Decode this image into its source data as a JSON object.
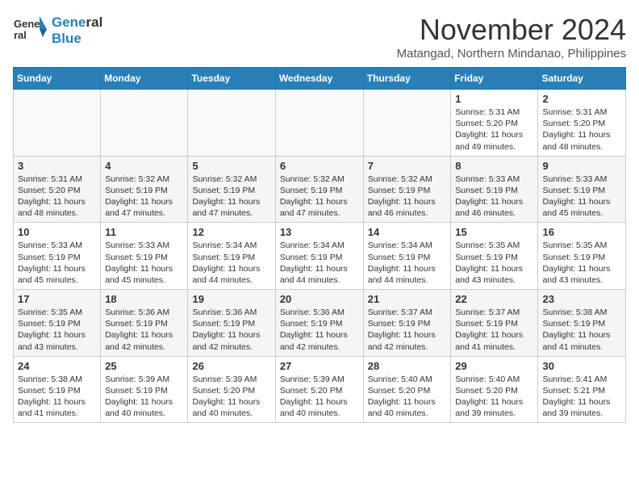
{
  "logo": {
    "name_line1": "General",
    "name_line2": "Blue"
  },
  "title": {
    "month_year": "November 2024",
    "location": "Matangad, Northern Mindanao, Philippines"
  },
  "weekdays": [
    "Sunday",
    "Monday",
    "Tuesday",
    "Wednesday",
    "Thursday",
    "Friday",
    "Saturday"
  ],
  "weeks": [
    [
      {
        "day": "",
        "info": ""
      },
      {
        "day": "",
        "info": ""
      },
      {
        "day": "",
        "info": ""
      },
      {
        "day": "",
        "info": ""
      },
      {
        "day": "",
        "info": ""
      },
      {
        "day": "1",
        "info": "Sunrise: 5:31 AM\nSunset: 5:20 PM\nDaylight: 11 hours and 49 minutes."
      },
      {
        "day": "2",
        "info": "Sunrise: 5:31 AM\nSunset: 5:20 PM\nDaylight: 11 hours and 48 minutes."
      }
    ],
    [
      {
        "day": "3",
        "info": "Sunrise: 5:31 AM\nSunset: 5:20 PM\nDaylight: 11 hours and 48 minutes."
      },
      {
        "day": "4",
        "info": "Sunrise: 5:32 AM\nSunset: 5:19 PM\nDaylight: 11 hours and 47 minutes."
      },
      {
        "day": "5",
        "info": "Sunrise: 5:32 AM\nSunset: 5:19 PM\nDaylight: 11 hours and 47 minutes."
      },
      {
        "day": "6",
        "info": "Sunrise: 5:32 AM\nSunset: 5:19 PM\nDaylight: 11 hours and 47 minutes."
      },
      {
        "day": "7",
        "info": "Sunrise: 5:32 AM\nSunset: 5:19 PM\nDaylight: 11 hours and 46 minutes."
      },
      {
        "day": "8",
        "info": "Sunrise: 5:33 AM\nSunset: 5:19 PM\nDaylight: 11 hours and 46 minutes."
      },
      {
        "day": "9",
        "info": "Sunrise: 5:33 AM\nSunset: 5:19 PM\nDaylight: 11 hours and 45 minutes."
      }
    ],
    [
      {
        "day": "10",
        "info": "Sunrise: 5:33 AM\nSunset: 5:19 PM\nDaylight: 11 hours and 45 minutes."
      },
      {
        "day": "11",
        "info": "Sunrise: 5:33 AM\nSunset: 5:19 PM\nDaylight: 11 hours and 45 minutes."
      },
      {
        "day": "12",
        "info": "Sunrise: 5:34 AM\nSunset: 5:19 PM\nDaylight: 11 hours and 44 minutes."
      },
      {
        "day": "13",
        "info": "Sunrise: 5:34 AM\nSunset: 5:19 PM\nDaylight: 11 hours and 44 minutes."
      },
      {
        "day": "14",
        "info": "Sunrise: 5:34 AM\nSunset: 5:19 PM\nDaylight: 11 hours and 44 minutes."
      },
      {
        "day": "15",
        "info": "Sunrise: 5:35 AM\nSunset: 5:19 PM\nDaylight: 11 hours and 43 minutes."
      },
      {
        "day": "16",
        "info": "Sunrise: 5:35 AM\nSunset: 5:19 PM\nDaylight: 11 hours and 43 minutes."
      }
    ],
    [
      {
        "day": "17",
        "info": "Sunrise: 5:35 AM\nSunset: 5:19 PM\nDaylight: 11 hours and 43 minutes."
      },
      {
        "day": "18",
        "info": "Sunrise: 5:36 AM\nSunset: 5:19 PM\nDaylight: 11 hours and 42 minutes."
      },
      {
        "day": "19",
        "info": "Sunrise: 5:36 AM\nSunset: 5:19 PM\nDaylight: 11 hours and 42 minutes."
      },
      {
        "day": "20",
        "info": "Sunrise: 5:36 AM\nSunset: 5:19 PM\nDaylight: 11 hours and 42 minutes."
      },
      {
        "day": "21",
        "info": "Sunrise: 5:37 AM\nSunset: 5:19 PM\nDaylight: 11 hours and 42 minutes."
      },
      {
        "day": "22",
        "info": "Sunrise: 5:37 AM\nSunset: 5:19 PM\nDaylight: 11 hours and 41 minutes."
      },
      {
        "day": "23",
        "info": "Sunrise: 5:38 AM\nSunset: 5:19 PM\nDaylight: 11 hours and 41 minutes."
      }
    ],
    [
      {
        "day": "24",
        "info": "Sunrise: 5:38 AM\nSunset: 5:19 PM\nDaylight: 11 hours and 41 minutes."
      },
      {
        "day": "25",
        "info": "Sunrise: 5:39 AM\nSunset: 5:19 PM\nDaylight: 11 hours and 40 minutes."
      },
      {
        "day": "26",
        "info": "Sunrise: 5:39 AM\nSunset: 5:20 PM\nDaylight: 11 hours and 40 minutes."
      },
      {
        "day": "27",
        "info": "Sunrise: 5:39 AM\nSunset: 5:20 PM\nDaylight: 11 hours and 40 minutes."
      },
      {
        "day": "28",
        "info": "Sunrise: 5:40 AM\nSunset: 5:20 PM\nDaylight: 11 hours and 40 minutes."
      },
      {
        "day": "29",
        "info": "Sunrise: 5:40 AM\nSunset: 5:20 PM\nDaylight: 11 hours and 39 minutes."
      },
      {
        "day": "30",
        "info": "Sunrise: 5:41 AM\nSunset: 5:21 PM\nDaylight: 11 hours and 39 minutes."
      }
    ]
  ]
}
